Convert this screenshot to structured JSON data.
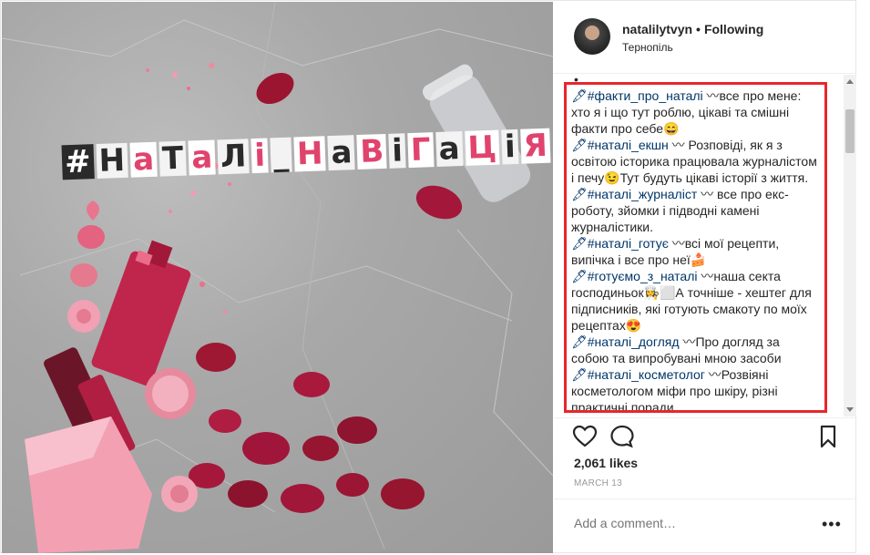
{
  "post": {
    "title_tiles": [
      "#",
      "Н",
      "а",
      "Т",
      "а",
      "Л",
      "і",
      "_",
      "Н",
      "а",
      "В",
      "і",
      "Г",
      "а",
      "Ц",
      "і",
      "Я"
    ],
    "username": "natalilytvyn",
    "separator": "•",
    "follow_status": "Following",
    "location": "Тернопіль",
    "bullet": "•",
    "caption": [
      {
        "tag": "🖋#факти_про_наталі",
        "text": " 〰все про мене: хто я і що тут роблю, цікаві та смішні факти про себе😄"
      },
      {
        "tag": "🖋#наталі_екшн",
        "text": " 〰 Розповіді, як я з освітою історика працювала журналістом і печу😉Тут будуть цікаві історії з життя."
      },
      {
        "tag": "🖋#наталі_журналіст",
        "text": " 〰 все про екс-роботу, зйомки і підводні камені журналістики."
      },
      {
        "tag": "🖋#наталі_готує",
        "text": " 〰всі мої рецепти, випічка і все про неї🍰"
      },
      {
        "tag": "🖋#готуємо_з_наталі",
        "text": " 〰наша секта господиньок👩‍🍳⬜А точніше - хештег для підписників, які готують смакоту по моїх рецептах😍"
      },
      {
        "tag": "🖋#наталі_догляд",
        "text": " 〰Про догляд за собою та випробувані мною засоби"
      },
      {
        "tag": "🖋#наталі_косметолог",
        "text": " 〰Розвіяні косметологом міфи про шкіру, різні практичні поради"
      }
    ],
    "likes": "2,061 likes",
    "date": "MARCH 13",
    "comment_placeholder": "Add a comment…",
    "more_label": "•••",
    "icons": [
      "heart-icon",
      "comment-icon",
      "bookmark-icon",
      "more-options-icon"
    ],
    "highlight_color": "#e8262b"
  }
}
